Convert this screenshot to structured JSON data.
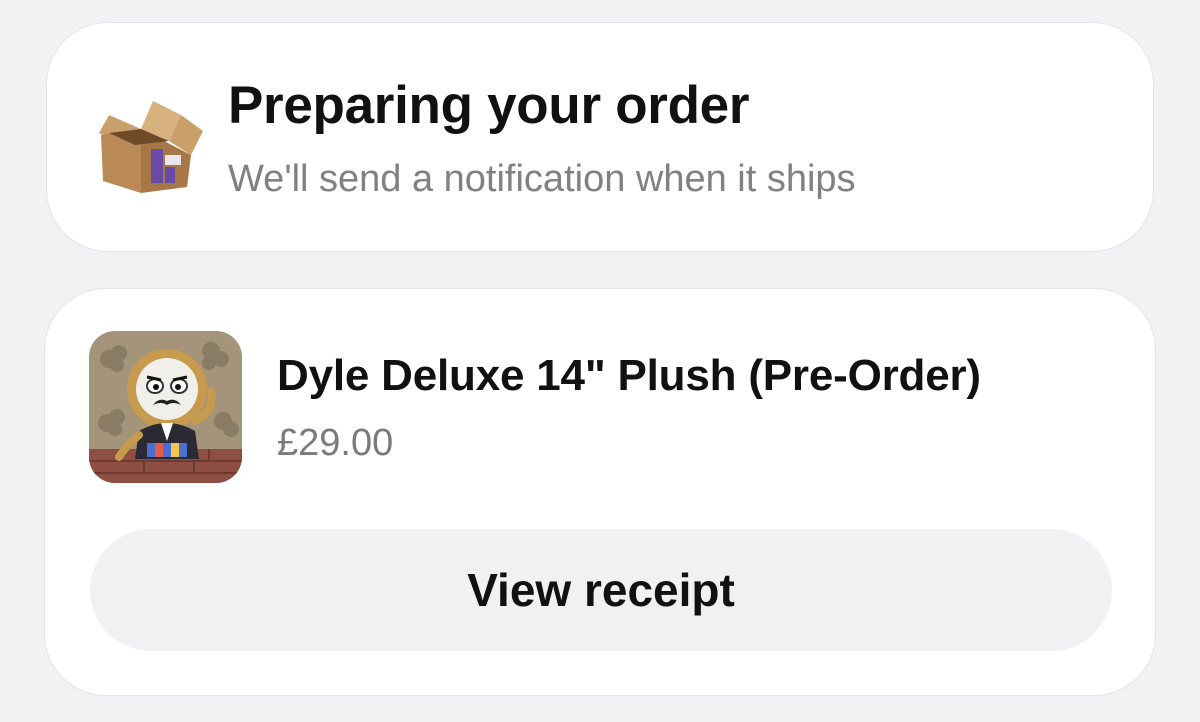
{
  "status_card": {
    "icon": "cardboard-box-icon",
    "title": "Preparing your order",
    "subtitle": "We'll send a notification when it ships"
  },
  "order_item": {
    "image": "plush-product-thumbnail",
    "name": "Dyle Deluxe 14\" Plush (Pre-Order)",
    "price": "£29.00"
  },
  "actions": {
    "view_receipt_label": "View receipt"
  },
  "colors": {
    "page_background": "#f2f2f4",
    "card_background": "#ffffff",
    "primary_text": "#111111",
    "secondary_text": "#808085",
    "button_background": "#f1f1f3",
    "box_tape_accent": "#6a4aa8"
  }
}
